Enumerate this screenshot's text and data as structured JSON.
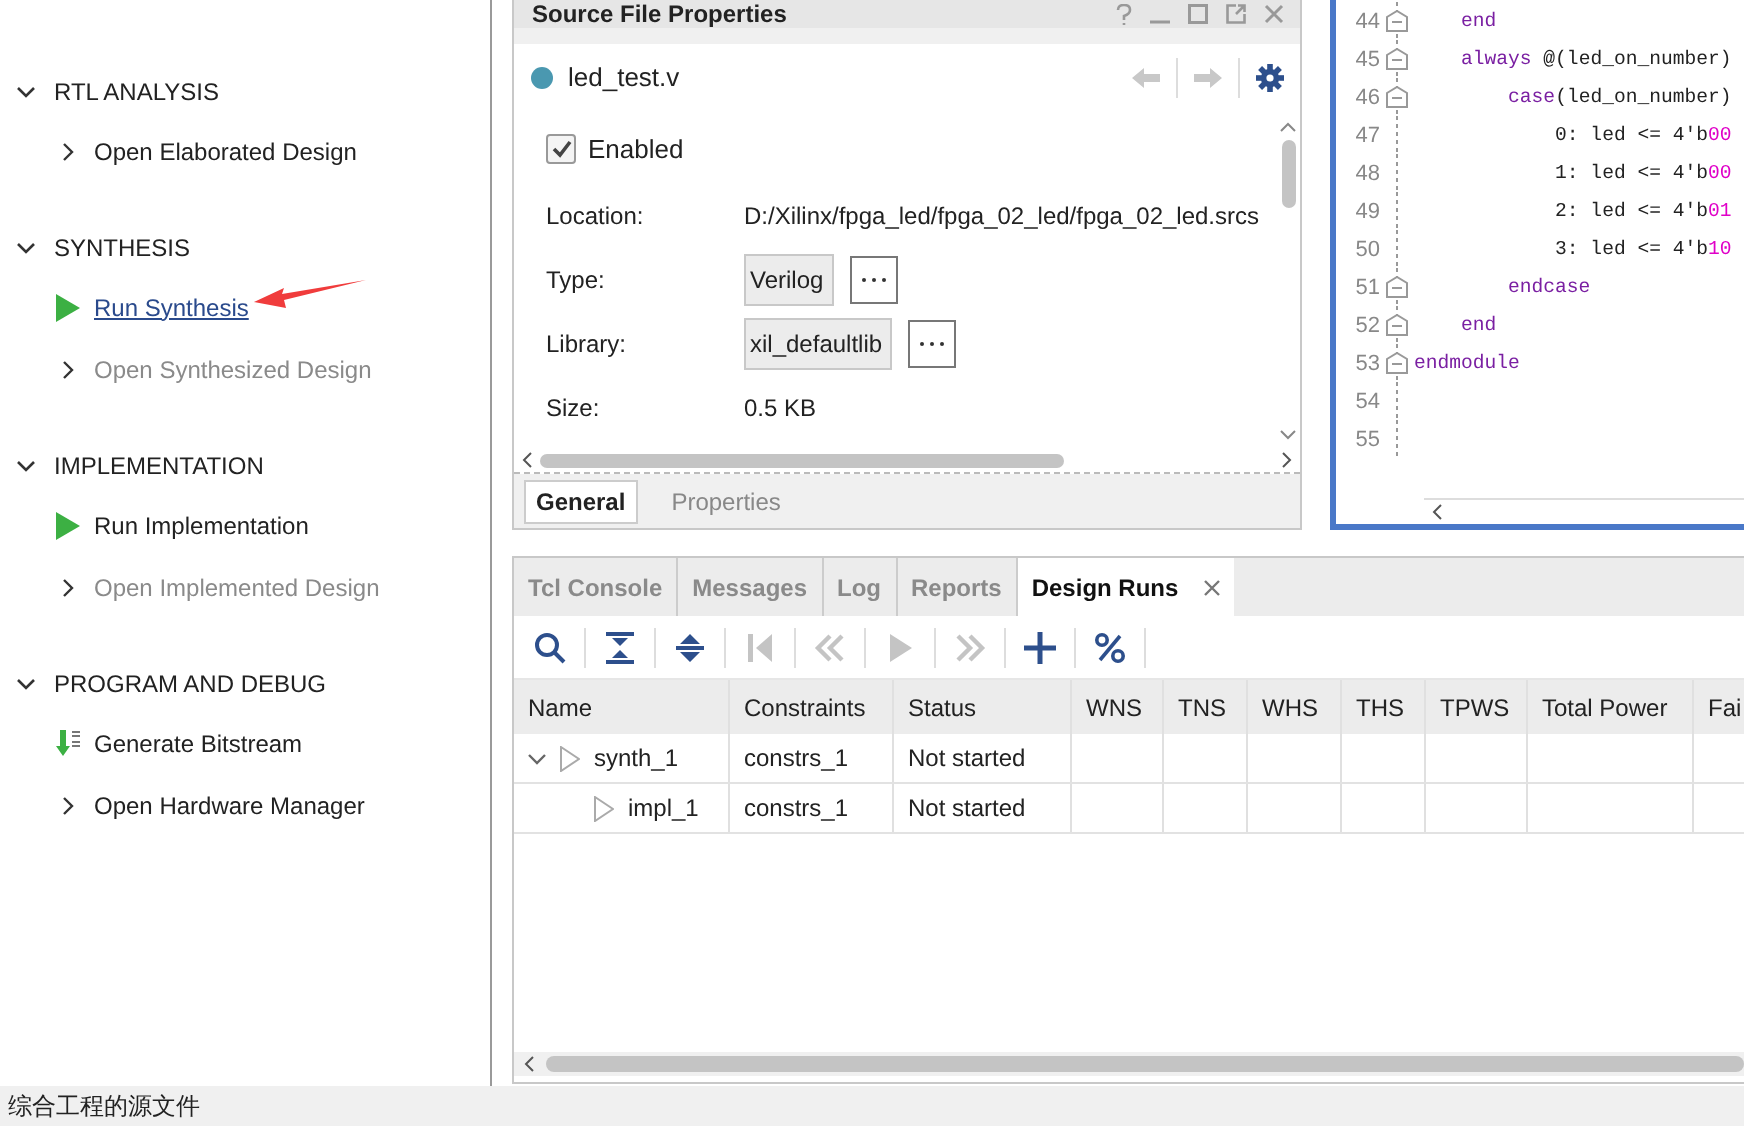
{
  "nav": {
    "sections": [
      {
        "title": "RTL ANALYSIS",
        "expanded": true,
        "items": [
          {
            "kind": "open",
            "label": "Open Elaborated Design",
            "disabled": false,
            "hovered": false,
            "marked": false
          }
        ]
      },
      {
        "title": "SYNTHESIS",
        "expanded": true,
        "items": [
          {
            "kind": "run",
            "label": "Run Synthesis",
            "disabled": false,
            "hovered": true,
            "marked": true
          },
          {
            "kind": "open",
            "label": "Open Synthesized Design",
            "disabled": true,
            "hovered": false,
            "marked": false
          }
        ]
      },
      {
        "title": "IMPLEMENTATION",
        "expanded": true,
        "items": [
          {
            "kind": "run",
            "label": "Run Implementation",
            "disabled": false,
            "hovered": false,
            "marked": false
          },
          {
            "kind": "open",
            "label": "Open Implemented Design",
            "disabled": true,
            "hovered": false,
            "marked": false
          }
        ]
      },
      {
        "title": "PROGRAM AND DEBUG",
        "expanded": true,
        "items": [
          {
            "kind": "bitstream",
            "label": "Generate Bitstream",
            "disabled": false,
            "hovered": false,
            "marked": false
          },
          {
            "kind": "open",
            "label": "Open Hardware Manager",
            "disabled": false,
            "hovered": false,
            "marked": false
          }
        ]
      }
    ]
  },
  "properties": {
    "title": "Source File Properties",
    "file": "led_test.v",
    "enabled": {
      "label": "Enabled",
      "checked": true
    },
    "fields": [
      {
        "kind": "text",
        "label": "Location:",
        "value": "D:/Xilinx/fpga_led/fpga_02_led/fpga_02_led.srcs"
      },
      {
        "kind": "choice",
        "label": "Type:",
        "value": "Verilog"
      },
      {
        "kind": "choice",
        "label": "Library:",
        "value": "xil_defaultlib"
      },
      {
        "kind": "text",
        "label": "Size:",
        "value": "0.5 KB"
      }
    ],
    "tabs": [
      {
        "label": "General",
        "selected": true
      },
      {
        "label": "Properties",
        "selected": false
      }
    ]
  },
  "editor": {
    "lines": [
      {
        "number": "44",
        "fold": true,
        "tokens": [
          {
            "kind": "kw",
            "text": "    end"
          }
        ]
      },
      {
        "number": "45",
        "fold": true,
        "tokens": [
          {
            "kind": "kw",
            "text": "    always"
          },
          {
            "kind": "plain",
            "text": " @(led_on_number)"
          }
        ]
      },
      {
        "number": "46",
        "fold": true,
        "tokens": [
          {
            "kind": "kw",
            "text": "        case"
          },
          {
            "kind": "plain",
            "text": "(led_on_number)"
          }
        ]
      },
      {
        "number": "47",
        "fold": false,
        "tokens": [
          {
            "kind": "plain",
            "text": "            0: led <= 4'b"
          },
          {
            "kind": "num",
            "text": "00"
          }
        ]
      },
      {
        "number": "48",
        "fold": false,
        "tokens": [
          {
            "kind": "plain",
            "text": "            1: led <= 4'b"
          },
          {
            "kind": "num",
            "text": "00"
          }
        ]
      },
      {
        "number": "49",
        "fold": false,
        "tokens": [
          {
            "kind": "plain",
            "text": "            2: led <= 4'b"
          },
          {
            "kind": "num",
            "text": "01"
          }
        ]
      },
      {
        "number": "50",
        "fold": false,
        "tokens": [
          {
            "kind": "plain",
            "text": "            3: led <= 4'b"
          },
          {
            "kind": "num",
            "text": "10"
          }
        ]
      },
      {
        "number": "51",
        "fold": true,
        "tokens": [
          {
            "kind": "kw",
            "text": "        endcase"
          }
        ]
      },
      {
        "number": "52",
        "fold": true,
        "tokens": [
          {
            "kind": "kw",
            "text": "    end"
          }
        ]
      },
      {
        "number": "53",
        "fold": true,
        "tokens": [
          {
            "kind": "kw",
            "text": "endmodule"
          }
        ]
      },
      {
        "number": "54",
        "fold": false
      },
      {
        "number": "55",
        "fold": false
      }
    ]
  },
  "runs": {
    "tabs": [
      {
        "label": "Tcl Console",
        "selected": false,
        "closable": false
      },
      {
        "label": "Messages",
        "selected": false,
        "closable": false
      },
      {
        "label": "Log",
        "selected": false,
        "closable": false
      },
      {
        "label": "Reports",
        "selected": false,
        "closable": false
      },
      {
        "label": "Design Runs",
        "selected": true,
        "closable": true
      }
    ],
    "toolbar": [
      {
        "kind": "search",
        "disabled": false
      },
      {
        "kind": "collapse",
        "disabled": false
      },
      {
        "kind": "expand",
        "disabled": false
      },
      {
        "kind": "first",
        "disabled": true
      },
      {
        "kind": "previous",
        "disabled": true
      },
      {
        "kind": "play",
        "disabled": true
      },
      {
        "kind": "next",
        "disabled": true
      },
      {
        "kind": "add",
        "disabled": false
      },
      {
        "kind": "percent",
        "disabled": false
      }
    ],
    "columns": [
      "Name",
      "Constraints",
      "Status",
      "WNS",
      "TNS",
      "WHS",
      "THS",
      "TPWS",
      "Total Power",
      "Fai"
    ],
    "rows": [
      {
        "name": "synth_1",
        "constraints": "constrs_1",
        "status": "Not started",
        "expanded": true,
        "children": [
          {
            "name": "impl_1",
            "constraints": "constrs_1",
            "status": "Not started"
          }
        ]
      }
    ]
  },
  "status_bar": "综合工程的源文件"
}
